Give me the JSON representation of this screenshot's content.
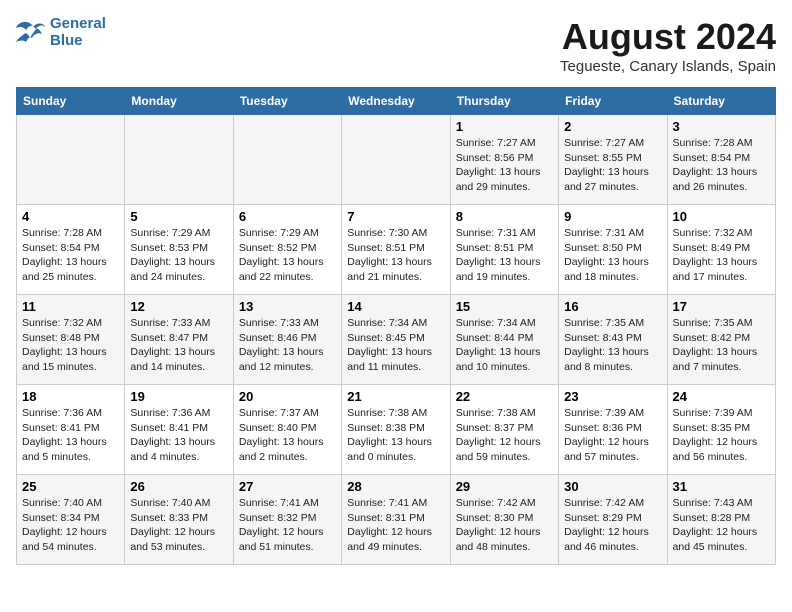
{
  "header": {
    "logo_line1": "General",
    "logo_line2": "Blue",
    "month_year": "August 2024",
    "location": "Tegueste, Canary Islands, Spain"
  },
  "weekdays": [
    "Sunday",
    "Monday",
    "Tuesday",
    "Wednesday",
    "Thursday",
    "Friday",
    "Saturday"
  ],
  "weeks": [
    [
      {
        "day": "",
        "info": ""
      },
      {
        "day": "",
        "info": ""
      },
      {
        "day": "",
        "info": ""
      },
      {
        "day": "",
        "info": ""
      },
      {
        "day": "1",
        "info": "Sunrise: 7:27 AM\nSunset: 8:56 PM\nDaylight: 13 hours\nand 29 minutes."
      },
      {
        "day": "2",
        "info": "Sunrise: 7:27 AM\nSunset: 8:55 PM\nDaylight: 13 hours\nand 27 minutes."
      },
      {
        "day": "3",
        "info": "Sunrise: 7:28 AM\nSunset: 8:54 PM\nDaylight: 13 hours\nand 26 minutes."
      }
    ],
    [
      {
        "day": "4",
        "info": "Sunrise: 7:28 AM\nSunset: 8:54 PM\nDaylight: 13 hours\nand 25 minutes."
      },
      {
        "day": "5",
        "info": "Sunrise: 7:29 AM\nSunset: 8:53 PM\nDaylight: 13 hours\nand 24 minutes."
      },
      {
        "day": "6",
        "info": "Sunrise: 7:29 AM\nSunset: 8:52 PM\nDaylight: 13 hours\nand 22 minutes."
      },
      {
        "day": "7",
        "info": "Sunrise: 7:30 AM\nSunset: 8:51 PM\nDaylight: 13 hours\nand 21 minutes."
      },
      {
        "day": "8",
        "info": "Sunrise: 7:31 AM\nSunset: 8:51 PM\nDaylight: 13 hours\nand 19 minutes."
      },
      {
        "day": "9",
        "info": "Sunrise: 7:31 AM\nSunset: 8:50 PM\nDaylight: 13 hours\nand 18 minutes."
      },
      {
        "day": "10",
        "info": "Sunrise: 7:32 AM\nSunset: 8:49 PM\nDaylight: 13 hours\nand 17 minutes."
      }
    ],
    [
      {
        "day": "11",
        "info": "Sunrise: 7:32 AM\nSunset: 8:48 PM\nDaylight: 13 hours\nand 15 minutes."
      },
      {
        "day": "12",
        "info": "Sunrise: 7:33 AM\nSunset: 8:47 PM\nDaylight: 13 hours\nand 14 minutes."
      },
      {
        "day": "13",
        "info": "Sunrise: 7:33 AM\nSunset: 8:46 PM\nDaylight: 13 hours\nand 12 minutes."
      },
      {
        "day": "14",
        "info": "Sunrise: 7:34 AM\nSunset: 8:45 PM\nDaylight: 13 hours\nand 11 minutes."
      },
      {
        "day": "15",
        "info": "Sunrise: 7:34 AM\nSunset: 8:44 PM\nDaylight: 13 hours\nand 10 minutes."
      },
      {
        "day": "16",
        "info": "Sunrise: 7:35 AM\nSunset: 8:43 PM\nDaylight: 13 hours\nand 8 minutes."
      },
      {
        "day": "17",
        "info": "Sunrise: 7:35 AM\nSunset: 8:42 PM\nDaylight: 13 hours\nand 7 minutes."
      }
    ],
    [
      {
        "day": "18",
        "info": "Sunrise: 7:36 AM\nSunset: 8:41 PM\nDaylight: 13 hours\nand 5 minutes."
      },
      {
        "day": "19",
        "info": "Sunrise: 7:36 AM\nSunset: 8:41 PM\nDaylight: 13 hours\nand 4 minutes."
      },
      {
        "day": "20",
        "info": "Sunrise: 7:37 AM\nSunset: 8:40 PM\nDaylight: 13 hours\nand 2 minutes."
      },
      {
        "day": "21",
        "info": "Sunrise: 7:38 AM\nSunset: 8:38 PM\nDaylight: 13 hours\nand 0 minutes."
      },
      {
        "day": "22",
        "info": "Sunrise: 7:38 AM\nSunset: 8:37 PM\nDaylight: 12 hours\nand 59 minutes."
      },
      {
        "day": "23",
        "info": "Sunrise: 7:39 AM\nSunset: 8:36 PM\nDaylight: 12 hours\nand 57 minutes."
      },
      {
        "day": "24",
        "info": "Sunrise: 7:39 AM\nSunset: 8:35 PM\nDaylight: 12 hours\nand 56 minutes."
      }
    ],
    [
      {
        "day": "25",
        "info": "Sunrise: 7:40 AM\nSunset: 8:34 PM\nDaylight: 12 hours\nand 54 minutes."
      },
      {
        "day": "26",
        "info": "Sunrise: 7:40 AM\nSunset: 8:33 PM\nDaylight: 12 hours\nand 53 minutes."
      },
      {
        "day": "27",
        "info": "Sunrise: 7:41 AM\nSunset: 8:32 PM\nDaylight: 12 hours\nand 51 minutes."
      },
      {
        "day": "28",
        "info": "Sunrise: 7:41 AM\nSunset: 8:31 PM\nDaylight: 12 hours\nand 49 minutes."
      },
      {
        "day": "29",
        "info": "Sunrise: 7:42 AM\nSunset: 8:30 PM\nDaylight: 12 hours\nand 48 minutes."
      },
      {
        "day": "30",
        "info": "Sunrise: 7:42 AM\nSunset: 8:29 PM\nDaylight: 12 hours\nand 46 minutes."
      },
      {
        "day": "31",
        "info": "Sunrise: 7:43 AM\nSunset: 8:28 PM\nDaylight: 12 hours\nand 45 minutes."
      }
    ]
  ]
}
